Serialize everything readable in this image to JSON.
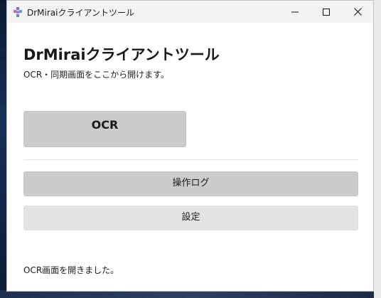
{
  "window": {
    "title": "DrMiraiクライアントツール"
  },
  "titlebar_controls": {
    "minimize_icon": "minimize-icon",
    "maximize_icon": "maximize-icon",
    "close_icon": "close-icon"
  },
  "main": {
    "heading": "DrMiraiクライアントツール",
    "subtitle": "OCR・同期画面をここから開けます。",
    "ocr_button": "OCR",
    "log_button": "操作ログ",
    "settings_button": "設定",
    "status": "OCR画面を開きました。"
  },
  "colors": {
    "primary_button": "#cbcbcb",
    "secondary_button": "#e3e3e3",
    "titlebar": "#f3f3f3",
    "desktop": "#2b3a55"
  }
}
